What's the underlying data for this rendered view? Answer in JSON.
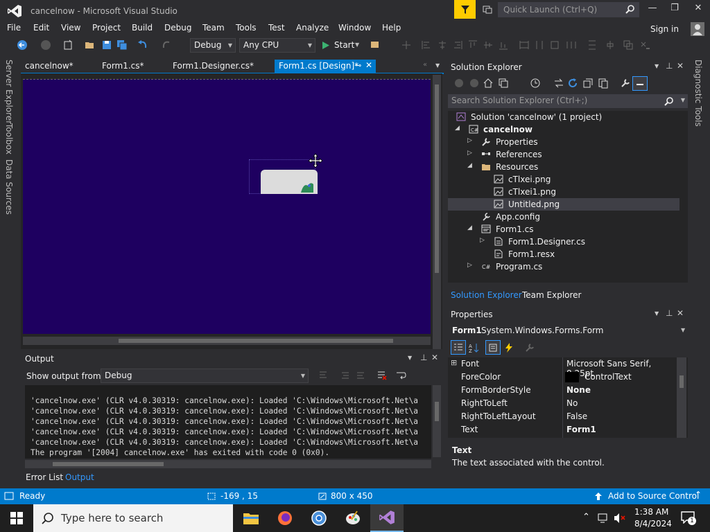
{
  "window": {
    "title": "cancelnow - Microsoft Visual Studio",
    "quick_launch_placeholder": "Quick Launch (Ctrl+Q)",
    "minimize": "—",
    "restore": "❐",
    "close": "✕"
  },
  "menu": [
    "File",
    "Edit",
    "View",
    "Project",
    "Build",
    "Debug",
    "Team",
    "Tools",
    "Test",
    "Analyze",
    "Window",
    "Help"
  ],
  "sign_in": "Sign in",
  "toolbar": {
    "config": "Debug",
    "platform": "Any CPU",
    "start": "Start"
  },
  "side_tabs": [
    "Server Explorer",
    "Toolbox",
    "Data Sources"
  ],
  "right_tab": "Diagnostic Tools",
  "doc_tabs": [
    {
      "label": "cancelnow*"
    },
    {
      "label": "Form1.cs*"
    },
    {
      "label": "Form1.Designer.cs*"
    },
    {
      "label": "Form1.cs [Design]*"
    }
  ],
  "output": {
    "title": "Output",
    "show_from_label": "Show output from:",
    "show_from_value": "Debug",
    "lines": [
      "'cancelnow.exe' (CLR v4.0.30319: cancelnow.exe): Loaded 'C:\\Windows\\Microsoft.Net\\a",
      "'cancelnow.exe' (CLR v4.0.30319: cancelnow.exe): Loaded 'C:\\Windows\\Microsoft.Net\\a",
      "'cancelnow.exe' (CLR v4.0.30319: cancelnow.exe): Loaded 'C:\\Windows\\Microsoft.Net\\a",
      "'cancelnow.exe' (CLR v4.0.30319: cancelnow.exe): Loaded 'C:\\Windows\\Microsoft.Net\\a",
      "'cancelnow.exe' (CLR v4.0.30319: cancelnow.exe): Loaded 'C:\\Windows\\Microsoft.Net\\a",
      "The program '[2004] cancelnow.exe' has exited with code 0 (0x0)."
    ]
  },
  "bottom_tabs": [
    "Error List",
    "Output"
  ],
  "solution_explorer": {
    "title": "Solution Explorer",
    "search_placeholder": "Search Solution Explorer (Ctrl+;)",
    "tree": [
      {
        "label": "Solution 'cancelnow' (1 project)",
        "expander": ""
      },
      {
        "label": "cancelnow",
        "expander": "◢"
      },
      {
        "label": "Properties",
        "expander": "▷"
      },
      {
        "label": "References",
        "expander": "▷"
      },
      {
        "label": "Resources",
        "expander": "◢"
      },
      {
        "label": "cTlxei.png",
        "expander": ""
      },
      {
        "label": "cTlxei1.png",
        "expander": ""
      },
      {
        "label": "Untitled.png",
        "expander": ""
      },
      {
        "label": "App.config",
        "expander": ""
      },
      {
        "label": "Form1.cs",
        "expander": "◢"
      },
      {
        "label": "Form1.Designer.cs",
        "expander": "▷"
      },
      {
        "label": "Form1.resx",
        "expander": ""
      },
      {
        "label": "Program.cs",
        "expander": "▷"
      }
    ],
    "tabs": [
      "Solution Explorer",
      "Team Explorer"
    ]
  },
  "properties": {
    "title": "Properties",
    "object_name": "Form1",
    "object_type": "System.Windows.Forms.Form",
    "rows": [
      {
        "name": "Font",
        "value": "Microsoft Sans Serif, 8.25pt"
      },
      {
        "name": "ForeColor",
        "value": "ControlText"
      },
      {
        "name": "FormBorderStyle",
        "value": "None"
      },
      {
        "name": "RightToLeft",
        "value": "No"
      },
      {
        "name": "RightToLeftLayout",
        "value": "False"
      },
      {
        "name": "Text",
        "value": "Form1"
      }
    ],
    "desc_title": "Text",
    "desc_text": "The text associated with the control."
  },
  "status": {
    "ready": "Ready",
    "position": "-169 , 15",
    "size": "800 x 450",
    "source_control": "Add to Source Control"
  },
  "taskbar": {
    "search_placeholder": "Type here to search",
    "time": "1:38 AM",
    "date": "8/4/2024",
    "notifications": "1"
  },
  "colors": {
    "accent": "#007acc",
    "designer_bg": "#1e0060",
    "quick_launch_filter": "#ffcc00"
  }
}
